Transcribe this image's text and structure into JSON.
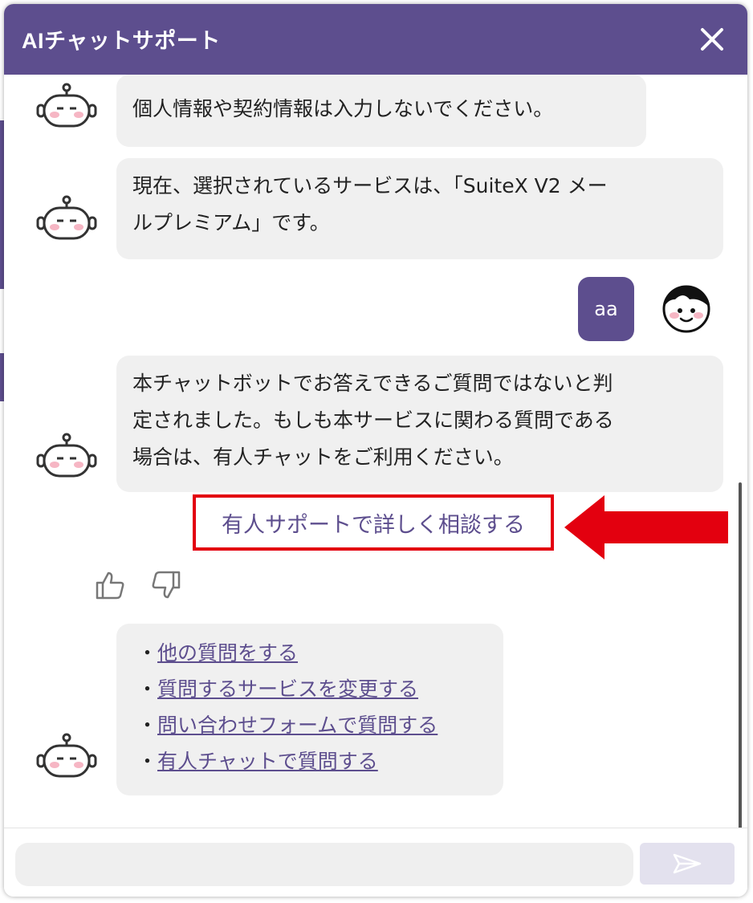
{
  "header": {
    "title": "AIチャットサポート"
  },
  "messages": {
    "bot_1": "個人情報や契約情報は入力しないでください。",
    "bot_2_line1": "現在、選択されているサービスは、「SuiteX V2 メー",
    "bot_2_line2": "ルプレミアム」です。",
    "user_1": "aa",
    "bot_3_line1": "本チャットボットでお答えできるご質問ではないと判",
    "bot_3_line2": "定されました。もしも本サービスに関わる質問である",
    "bot_3_line3": "場合は、有人チャットをご利用ください。",
    "human_support_link": "有人サポートで詳しく相談する"
  },
  "menu": {
    "bullet": "・",
    "items": [
      {
        "label": "他の質問をする"
      },
      {
        "label": "質問するサービスを変更する"
      },
      {
        "label": "問い合わせフォームで質問する"
      },
      {
        "label": "有人チャットで質問する"
      }
    ]
  },
  "input": {
    "value": "",
    "placeholder": ""
  },
  "colors": {
    "brand": "#5d4e8e",
    "bubble": "#f0f0f0",
    "highlight": "#e3000f"
  },
  "icons": [
    "close-icon",
    "robot-avatar-icon",
    "user-avatar-icon",
    "thumbs-up-icon",
    "thumbs-down-icon",
    "send-icon",
    "red-arrow-icon"
  ]
}
